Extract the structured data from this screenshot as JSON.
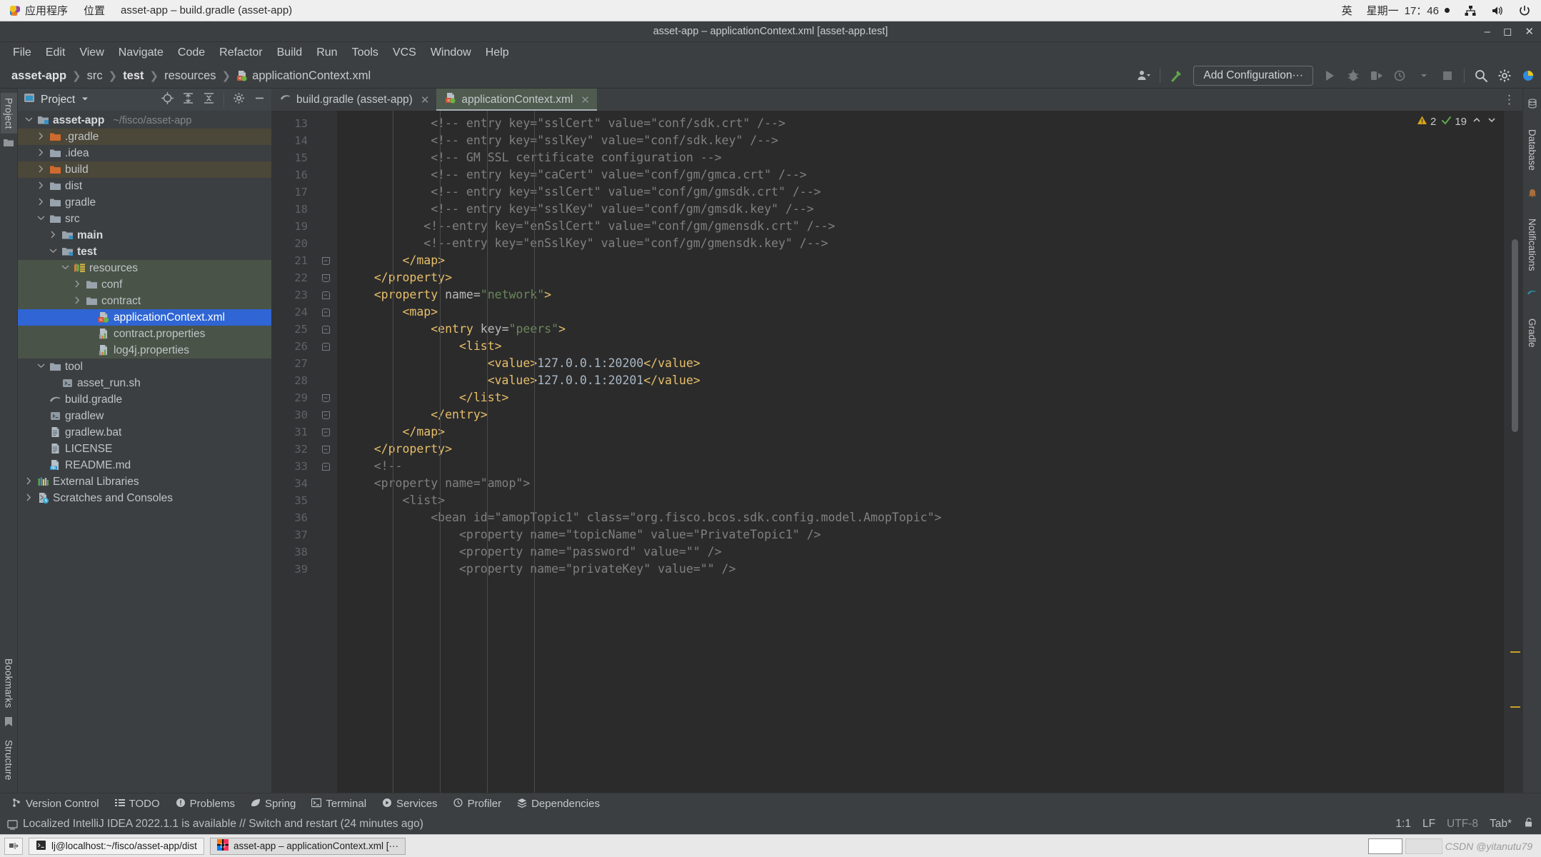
{
  "desktop": {
    "applications_label": "应用程序",
    "places_label": "位置",
    "window_title": "asset-app – build.gradle (asset-app)",
    "input_method": "英",
    "day": "星期一",
    "clock": "17：46",
    "icons": [
      "network-icon",
      "volume-icon",
      "power-icon"
    ]
  },
  "ide": {
    "title": "asset-app – applicationContext.xml [asset-app.test]",
    "window_buttons": [
      "minimize",
      "maximize",
      "close"
    ],
    "menu": [
      "File",
      "Edit",
      "View",
      "Navigate",
      "Code",
      "Refactor",
      "Build",
      "Run",
      "Tools",
      "VCS",
      "Window",
      "Help"
    ],
    "breadcrumb": [
      {
        "label": "asset-app",
        "bold": true,
        "icon": "none"
      },
      {
        "label": "src",
        "bold": false,
        "icon": "none"
      },
      {
        "label": "test",
        "bold": true,
        "icon": "none"
      },
      {
        "label": "resources",
        "bold": false,
        "icon": "none"
      },
      {
        "label": "applicationContext.xml",
        "bold": false,
        "icon": "xml-file-icon"
      }
    ],
    "toolbar": {
      "add_configuration_label": "Add Configuration···",
      "buttons": [
        "user-icon",
        "build-hammer-icon",
        "run-icon",
        "debug-icon",
        "run-with-coverage-icon",
        "profile-icon",
        "stop-icon",
        "search-icon",
        "settings-gear-icon",
        "ide-logo-icon"
      ]
    }
  },
  "project_panel": {
    "header_title": "Project",
    "header_icons": [
      "locate-icon",
      "expand-all-icon",
      "collapse-all-icon",
      "settings-gear-icon",
      "hide-icon"
    ],
    "tree": [
      {
        "label": "asset-app",
        "sub": "~/fisco/asset-app",
        "depth": 0,
        "arrow": "down",
        "icon": "module-folder-icon",
        "bold": true,
        "hl": "none"
      },
      {
        "label": ".gradle",
        "sub": "",
        "depth": 1,
        "arrow": "right",
        "icon": "folder-orange-icon",
        "bold": false,
        "hl": "brown"
      },
      {
        "label": ".idea",
        "sub": "",
        "depth": 1,
        "arrow": "right",
        "icon": "folder-icon",
        "bold": false,
        "hl": "none"
      },
      {
        "label": "build",
        "sub": "",
        "depth": 1,
        "arrow": "right",
        "icon": "folder-orange-icon",
        "bold": false,
        "hl": "brown"
      },
      {
        "label": "dist",
        "sub": "",
        "depth": 1,
        "arrow": "right",
        "icon": "folder-icon",
        "bold": false,
        "hl": "none"
      },
      {
        "label": "gradle",
        "sub": "",
        "depth": 1,
        "arrow": "right",
        "icon": "folder-icon",
        "bold": false,
        "hl": "none"
      },
      {
        "label": "src",
        "sub": "",
        "depth": 1,
        "arrow": "down",
        "icon": "folder-icon",
        "bold": false,
        "hl": "none"
      },
      {
        "label": "main",
        "sub": "",
        "depth": 2,
        "arrow": "right",
        "icon": "source-folder-icon",
        "bold": true,
        "hl": "none"
      },
      {
        "label": "test",
        "sub": "",
        "depth": 2,
        "arrow": "down",
        "icon": "test-folder-icon",
        "bold": true,
        "hl": "none"
      },
      {
        "label": "resources",
        "sub": "",
        "depth": 3,
        "arrow": "down",
        "icon": "resources-folder-icon",
        "bold": false,
        "hl": "green"
      },
      {
        "label": "conf",
        "sub": "",
        "depth": 4,
        "arrow": "right",
        "icon": "folder-icon",
        "bold": false,
        "hl": "green"
      },
      {
        "label": "contract",
        "sub": "",
        "depth": 4,
        "arrow": "right",
        "icon": "folder-icon",
        "bold": false,
        "hl": "green"
      },
      {
        "label": "applicationContext.xml",
        "sub": "",
        "depth": 5,
        "arrow": "none",
        "icon": "spring-xml-file-icon",
        "bold": false,
        "hl": "selected"
      },
      {
        "label": "contract.properties",
        "sub": "",
        "depth": 5,
        "arrow": "none",
        "icon": "properties-file-icon",
        "bold": false,
        "hl": "green"
      },
      {
        "label": "log4j.properties",
        "sub": "",
        "depth": 5,
        "arrow": "none",
        "icon": "properties-file-icon",
        "bold": false,
        "hl": "green"
      },
      {
        "label": "tool",
        "sub": "",
        "depth": 1,
        "arrow": "down",
        "icon": "folder-icon",
        "bold": false,
        "hl": "none"
      },
      {
        "label": "asset_run.sh",
        "sub": "",
        "depth": 2,
        "arrow": "none",
        "icon": "shell-script-icon",
        "bold": false,
        "hl": "none"
      },
      {
        "label": "build.gradle",
        "sub": "",
        "depth": 1,
        "arrow": "none",
        "icon": "gradle-file-icon",
        "bold": false,
        "hl": "none"
      },
      {
        "label": "gradlew",
        "sub": "",
        "depth": 1,
        "arrow": "none",
        "icon": "shell-script-icon",
        "bold": false,
        "hl": "none"
      },
      {
        "label": "gradlew.bat",
        "sub": "",
        "depth": 1,
        "arrow": "none",
        "icon": "text-file-icon",
        "bold": false,
        "hl": "none"
      },
      {
        "label": "LICENSE",
        "sub": "",
        "depth": 1,
        "arrow": "none",
        "icon": "text-file-icon",
        "bold": false,
        "hl": "none"
      },
      {
        "label": "README.md",
        "sub": "",
        "depth": 1,
        "arrow": "none",
        "icon": "markdown-file-icon",
        "bold": false,
        "hl": "none"
      },
      {
        "label": "External Libraries",
        "sub": "",
        "depth": 0,
        "arrow": "right",
        "icon": "libraries-icon",
        "bold": false,
        "hl": "none"
      },
      {
        "label": "Scratches and Consoles",
        "sub": "",
        "depth": 0,
        "arrow": "right",
        "icon": "scratches-icon",
        "bold": false,
        "hl": "none"
      }
    ]
  },
  "left_strip": {
    "tabs": [
      "Project",
      "Bookmarks",
      "Structure"
    ]
  },
  "right_strip": {
    "tabs": [
      "Database",
      "Notifications",
      "Gradle"
    ]
  },
  "editor": {
    "tabs": [
      {
        "label": "build.gradle (asset-app)",
        "icon": "gradle-file-icon",
        "active": false
      },
      {
        "label": "applicationContext.xml",
        "icon": "spring-xml-file-icon",
        "active": true
      }
    ],
    "inspection": {
      "warnings": "2",
      "weak_warnings": "19",
      "warn_icon": "warning-triangle-icon",
      "ok_icon": "check-icon"
    },
    "lines": [
      {
        "n": 13,
        "fold": "none",
        "segments": [
          {
            "t": "            ",
            "c": "txt"
          },
          {
            "t": "<!-- entry key=\"sslCert\" value=\"conf/sdk.crt\" /-->",
            "c": "cm"
          }
        ]
      },
      {
        "n": 14,
        "fold": "none",
        "segments": [
          {
            "t": "            ",
            "c": "txt"
          },
          {
            "t": "<!-- entry key=\"sslKey\" value=\"conf/sdk.key\" /-->",
            "c": "cm"
          }
        ]
      },
      {
        "n": 15,
        "fold": "none",
        "segments": [
          {
            "t": "            ",
            "c": "txt"
          },
          {
            "t": "<!-- GM SSL certificate configuration -->",
            "c": "cm"
          }
        ]
      },
      {
        "n": 16,
        "fold": "none",
        "segments": [
          {
            "t": "            ",
            "c": "txt"
          },
          {
            "t": "<!-- entry key=\"caCert\" value=\"conf/gm/gmca.crt\" /-->",
            "c": "cm"
          }
        ]
      },
      {
        "n": 17,
        "fold": "none",
        "segments": [
          {
            "t": "            ",
            "c": "txt"
          },
          {
            "t": "<!-- entry key=\"sslCert\" value=\"conf/gm/gmsdk.crt\" /-->",
            "c": "cm"
          }
        ]
      },
      {
        "n": 18,
        "fold": "none",
        "segments": [
          {
            "t": "            ",
            "c": "txt"
          },
          {
            "t": "<!-- entry key=\"sslKey\" value=\"conf/gm/gmsdk.key\" /-->",
            "c": "cm"
          }
        ]
      },
      {
        "n": 19,
        "fold": "none",
        "segments": [
          {
            "t": "           ",
            "c": "txt"
          },
          {
            "t": "<!--entry key=\"enSslCert\" value=\"conf/gm/gmensdk.crt\" /-->",
            "c": "cm"
          }
        ]
      },
      {
        "n": 20,
        "fold": "none",
        "segments": [
          {
            "t": "           ",
            "c": "txt"
          },
          {
            "t": "<!--entry key=\"enSslKey\" value=\"conf/gm/gmensdk.key\" /-->",
            "c": "cm"
          }
        ]
      },
      {
        "n": 21,
        "fold": "bot",
        "segments": [
          {
            "t": "        ",
            "c": "txt"
          },
          {
            "t": "</map>",
            "c": "tag"
          }
        ]
      },
      {
        "n": 22,
        "fold": "bot",
        "segments": [
          {
            "t": "    ",
            "c": "txt"
          },
          {
            "t": "</property>",
            "c": "tag"
          }
        ]
      },
      {
        "n": 23,
        "fold": "top",
        "segments": [
          {
            "t": "    ",
            "c": "txt"
          },
          {
            "t": "<property ",
            "c": "tag"
          },
          {
            "t": "name=",
            "c": "attr"
          },
          {
            "t": "\"network\"",
            "c": "val"
          },
          {
            "t": ">",
            "c": "tag"
          }
        ]
      },
      {
        "n": 24,
        "fold": "top",
        "segments": [
          {
            "t": "        ",
            "c": "txt"
          },
          {
            "t": "<map>",
            "c": "tag"
          }
        ]
      },
      {
        "n": 25,
        "fold": "top",
        "segments": [
          {
            "t": "            ",
            "c": "txt"
          },
          {
            "t": "<entry ",
            "c": "tag"
          },
          {
            "t": "key=",
            "c": "attr"
          },
          {
            "t": "\"peers\"",
            "c": "val"
          },
          {
            "t": ">",
            "c": "tag"
          }
        ]
      },
      {
        "n": 26,
        "fold": "top",
        "segments": [
          {
            "t": "                ",
            "c": "txt"
          },
          {
            "t": "<list>",
            "c": "tag"
          }
        ]
      },
      {
        "n": 27,
        "fold": "none",
        "segments": [
          {
            "t": "                    ",
            "c": "txt"
          },
          {
            "t": "<value>",
            "c": "tag"
          },
          {
            "t": "127.0.0.1:20200",
            "c": "txt"
          },
          {
            "t": "</value>",
            "c": "tag"
          }
        ]
      },
      {
        "n": 28,
        "fold": "none",
        "segments": [
          {
            "t": "                    ",
            "c": "txt"
          },
          {
            "t": "<value>",
            "c": "tag"
          },
          {
            "t": "127.0.0.1:20201",
            "c": "txt"
          },
          {
            "t": "</value>",
            "c": "tag"
          }
        ]
      },
      {
        "n": 29,
        "fold": "bot",
        "segments": [
          {
            "t": "                ",
            "c": "txt"
          },
          {
            "t": "</list>",
            "c": "tag"
          }
        ]
      },
      {
        "n": 30,
        "fold": "bot",
        "segments": [
          {
            "t": "            ",
            "c": "txt"
          },
          {
            "t": "</entry>",
            "c": "tag"
          }
        ]
      },
      {
        "n": 31,
        "fold": "bot",
        "segments": [
          {
            "t": "        ",
            "c": "txt"
          },
          {
            "t": "</map>",
            "c": "tag"
          }
        ]
      },
      {
        "n": 32,
        "fold": "bot",
        "segments": [
          {
            "t": "    ",
            "c": "txt"
          },
          {
            "t": "</property>",
            "c": "tag"
          }
        ]
      },
      {
        "n": 33,
        "fold": "top",
        "segments": [
          {
            "t": "    ",
            "c": "txt"
          },
          {
            "t": "<!--",
            "c": "cm"
          }
        ]
      },
      {
        "n": 34,
        "fold": "none",
        "segments": [
          {
            "t": "    ",
            "c": "txt"
          },
          {
            "t": "<property name=\"amop\">",
            "c": "cm"
          }
        ]
      },
      {
        "n": 35,
        "fold": "none",
        "segments": [
          {
            "t": "        ",
            "c": "txt"
          },
          {
            "t": "<list>",
            "c": "cm"
          }
        ]
      },
      {
        "n": 36,
        "fold": "none",
        "segments": [
          {
            "t": "            ",
            "c": "txt"
          },
          {
            "t": "<bean id=\"amopTopic1\" class=\"org.fisco.bcos.sdk.config.model.AmopTopic\">",
            "c": "cm"
          }
        ]
      },
      {
        "n": 37,
        "fold": "none",
        "segments": [
          {
            "t": "                ",
            "c": "txt"
          },
          {
            "t": "<property name=\"topicName\" value=\"PrivateTopic1\" />",
            "c": "cm"
          }
        ]
      },
      {
        "n": 38,
        "fold": "none",
        "segments": [
          {
            "t": "                ",
            "c": "txt"
          },
          {
            "t": "<property name=\"password\" value=\"\" />",
            "c": "cm"
          }
        ]
      },
      {
        "n": 39,
        "fold": "none",
        "segments": [
          {
            "t": "                ",
            "c": "txt"
          },
          {
            "t": "<property name=\"privateKey\" value=\"\" />",
            "c": "cm"
          }
        ]
      }
    ]
  },
  "bottom_tools": [
    {
      "label": "Version Control",
      "icon": "branch-icon"
    },
    {
      "label": "TODO",
      "icon": "todo-list-icon"
    },
    {
      "label": "Problems",
      "icon": "problems-icon"
    },
    {
      "label": "Spring",
      "icon": "spring-leaf-icon"
    },
    {
      "label": "Terminal",
      "icon": "terminal-icon"
    },
    {
      "label": "Services",
      "icon": "services-icon"
    },
    {
      "label": "Profiler",
      "icon": "profiler-icon"
    },
    {
      "label": "Dependencies",
      "icon": "dependencies-icon"
    }
  ],
  "status_bar": {
    "message": "Localized IntelliJ IDEA 2022.1.1 is available // Switch and restart (24 minutes ago)",
    "message_icon": "notification-icon",
    "caret_position": "1:1",
    "line_separator": "LF",
    "encoding": "UTF-8",
    "indent": "Tab*",
    "lock_icon": "unlocked-icon"
  },
  "taskbar": {
    "show_desktop_icon": "show-desktop-icon",
    "items": [
      {
        "label": "lj@localhost:~/fisco/asset-app/dist",
        "icon": "terminal-icon",
        "active": false
      },
      {
        "label": "asset-app – applicationContext.xml [···",
        "icon": "intellij-idea-icon",
        "active": true
      }
    ],
    "watermark": "CSDN @yitanutu79"
  },
  "colors": {
    "accent_selection": "#2f65d4",
    "tag": "#e8bf6a",
    "value": "#6a8759",
    "comment": "#808080",
    "editor_bg": "#2b2b2b",
    "panel_bg": "#3c3f41"
  }
}
